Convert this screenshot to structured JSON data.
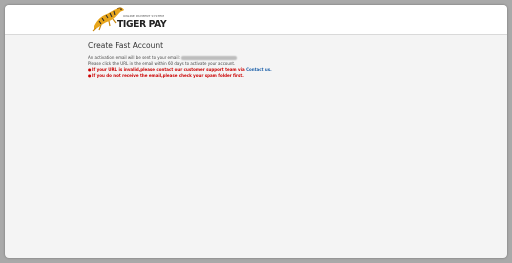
{
  "header": {
    "logo_tagline": "ONLINE PAYMENT SYSTEM",
    "logo_text": "TIGER PAY"
  },
  "main": {
    "title": "Create Fast Account",
    "info_line1_prefix": "An activation email will be sent to your email:",
    "info_line2": "Please click the URL in the email within 60 days to activate your account.",
    "warning1_bullet": "●",
    "warning1_text": "If your URL is invalid,please contact our customer support team via",
    "warning1_link": "Contact us.",
    "warning2_bullet": "●",
    "warning2_text": "If you do not receive the email,please check your spam folder first."
  },
  "colors": {
    "page_background": "#a9a9a9",
    "content_background": "#f4f4f4",
    "warning_red": "#cc0000",
    "link_blue": "#1a5ea8"
  },
  "icons": {
    "logo": "tiger-logo-icon"
  }
}
